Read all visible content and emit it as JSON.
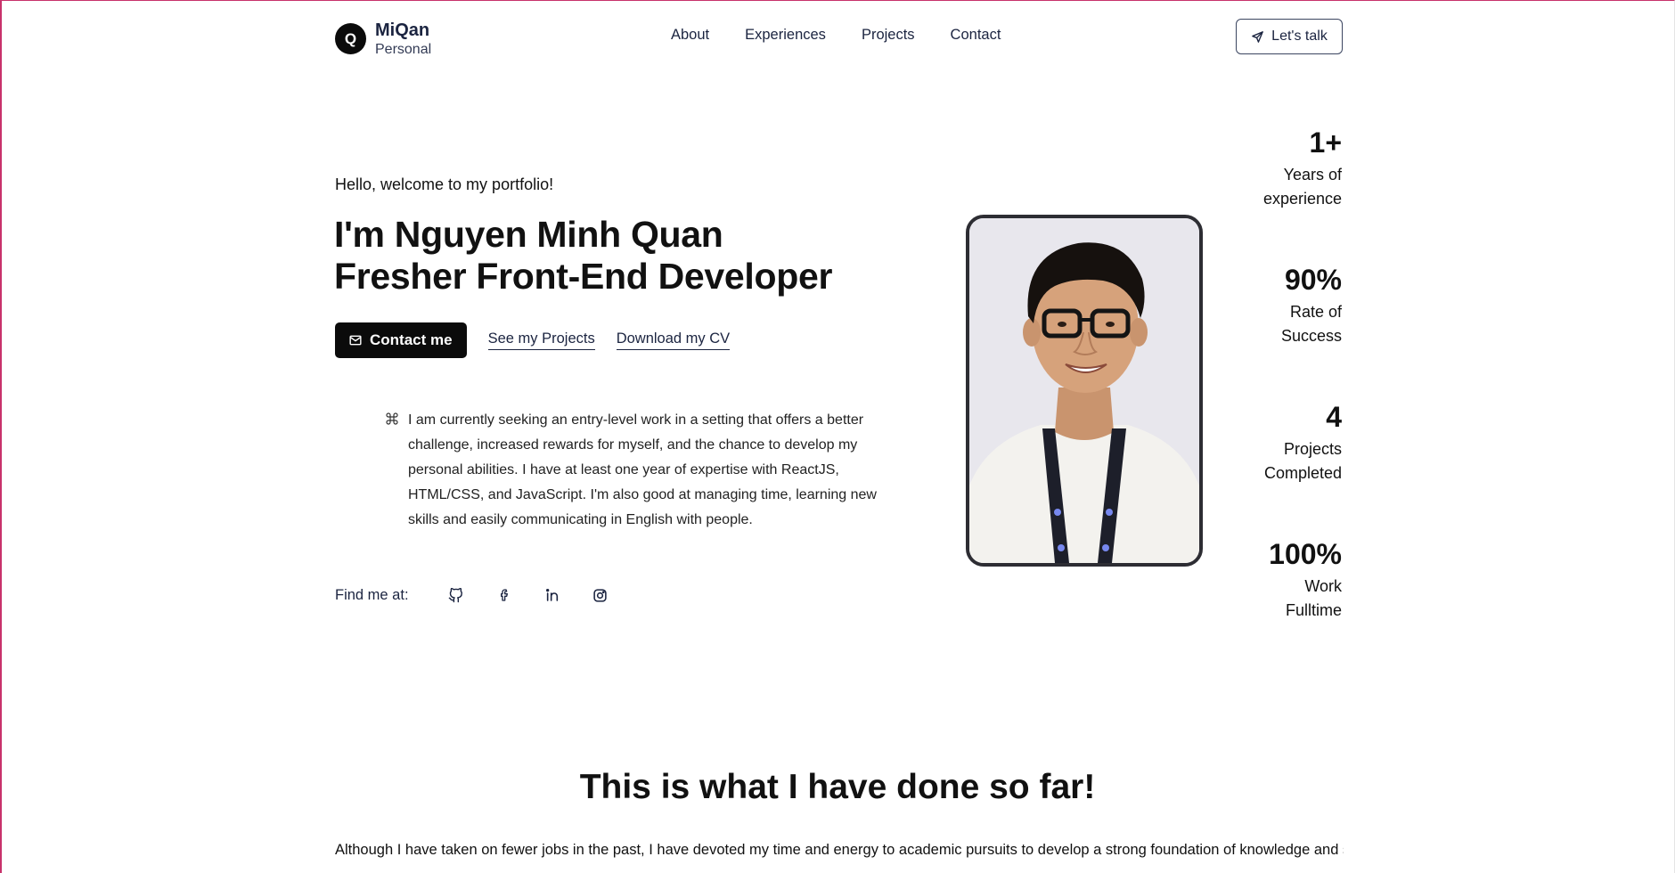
{
  "nav": {
    "logo_letter": "Q",
    "brand_name": "MiQan",
    "brand_sub": "Personal",
    "links": [
      "About",
      "Experiences",
      "Projects",
      "Contact"
    ],
    "cta_label": "Let's talk"
  },
  "hero": {
    "greeting": "Hello, welcome to my portfolio!",
    "title_line1": "I'm Nguyen Minh Quan",
    "title_line2": "Fresher Front-End Developer",
    "contact_label": "Contact me",
    "projects_link": "See my Projects",
    "cv_link": "Download my CV",
    "about": "I am currently seeking an entry-level work in a setting that offers a better challenge, increased rewards for myself, and the chance to develop my personal abilities. I have at least one year of expertise with ReactJS, HTML/CSS, and JavaScript. I'm also good at managing time, learning new skills and easily communicating in English with people.",
    "find_label": "Find me at:",
    "socials": [
      "github-icon",
      "facebook-icon",
      "linkedin-icon",
      "instagram-icon"
    ]
  },
  "stats": [
    {
      "value": "1+",
      "label_line1": "Years of",
      "label_line2": "experience"
    },
    {
      "value": "90%",
      "label_line1": "Rate of",
      "label_line2": "Success"
    },
    {
      "value": "4",
      "label_line1": "Projects",
      "label_line2": "Completed"
    },
    {
      "value": "100%",
      "label_line1": "Work",
      "label_line2": "Fulltime"
    }
  ],
  "section": {
    "title": "This is what I have done so far!",
    "text": "Although I have taken on fewer jobs in the past, I have devoted my time and energy to academic pursuits to develop a strong foundation of knowledge and skills."
  },
  "colors": {
    "accent_dark": "#0b0b0b",
    "nav_text": "#1b2440",
    "frame_border": "#c8326b"
  }
}
